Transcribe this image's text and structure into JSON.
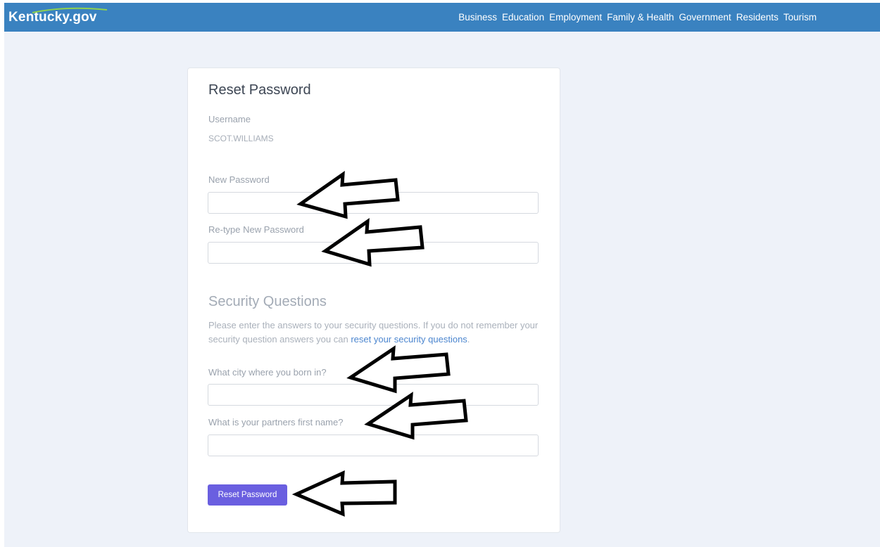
{
  "header": {
    "logo": "Kentucky.gov",
    "nav": [
      "Business",
      "Education",
      "Employment",
      "Family & Health",
      "Government",
      "Residents",
      "Tourism"
    ]
  },
  "form": {
    "title": "Reset Password",
    "username_label": "Username",
    "username_value": "SCOT.WILLIAMS",
    "new_password_label": "New Password",
    "new_password_value": "",
    "retype_password_label": "Re-type New Password",
    "retype_password_value": "",
    "security": {
      "title": "Security Questions",
      "help_text": "Please enter the answers to your security questions. If you do not remember your security question answers you can ",
      "help_link": "reset your security questions",
      "help_end": ".",
      "q1_label": "What city where you born in?",
      "q1_value": "",
      "q2_label": "What is your partners first name?",
      "q2_value": ""
    },
    "submit_label": "Reset Password"
  },
  "annotations": {
    "arrow_color": "#000000",
    "arrow_icon": "left-arrow-icon"
  }
}
